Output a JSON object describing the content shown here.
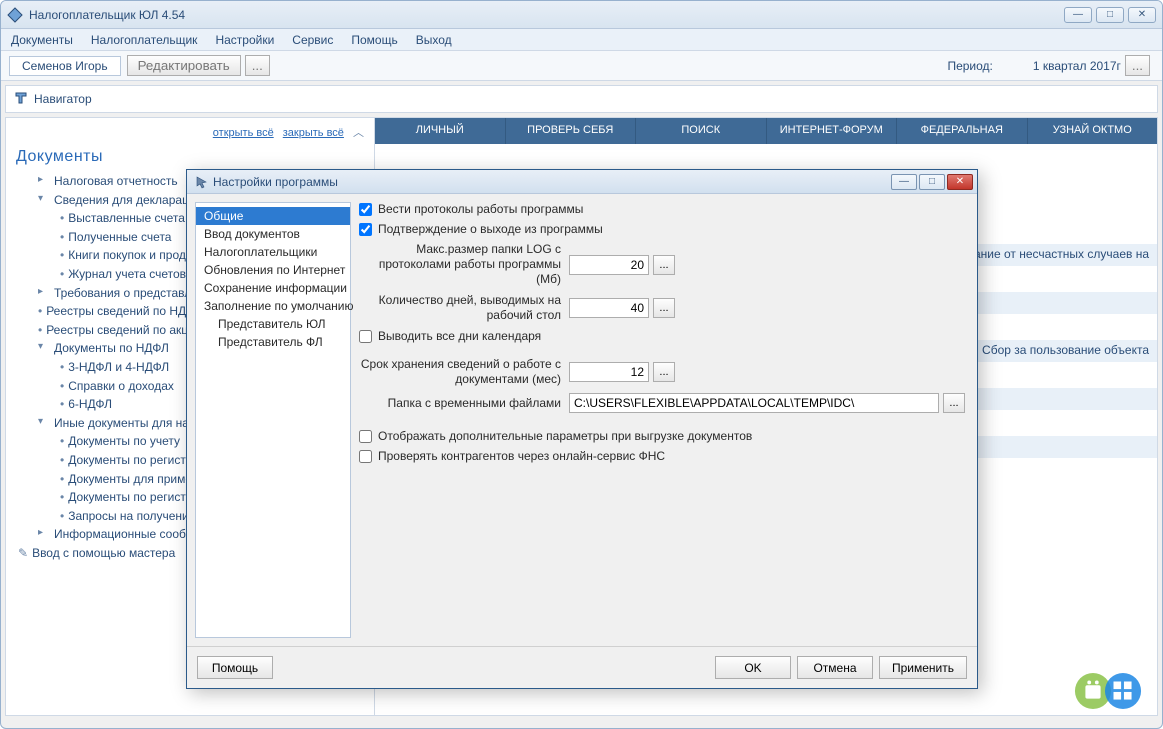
{
  "app": {
    "title": "Налогоплательщик ЮЛ 4.54"
  },
  "menubar": [
    "Документы",
    "Налогоплательщик",
    "Настройки",
    "Сервис",
    "Помощь",
    "Выход"
  ],
  "toolbar": {
    "user": "Семенов Игорь",
    "edit": "Редактировать",
    "ellipsis": "...",
    "period_label": "Период:",
    "period_value": "1 квартал 2017г"
  },
  "navigator": "Навигатор",
  "sidebar": {
    "open_all": "открыть всё",
    "close_all": "закрыть всё",
    "heading": "Документы",
    "tree": [
      {
        "level": 1,
        "arrow": "▸",
        "text": "Налоговая отчетность"
      },
      {
        "level": 1,
        "arrow": "▾",
        "text": "Сведения для декларации по ЕССС"
      },
      {
        "level": 2,
        "bullet": "•",
        "text": "Выставленные счета"
      },
      {
        "level": 2,
        "bullet": "•",
        "text": "Полученные счета"
      },
      {
        "level": 2,
        "bullet": "•",
        "text": "Книги покупок и продаж"
      },
      {
        "level": 2,
        "bullet": "•",
        "text": "Журнал учета счетов-фактур"
      },
      {
        "level": 1,
        "arrow": "▸",
        "text": "Требования о представлении"
      },
      {
        "level": 1,
        "bullet": "•",
        "text": "Реестры сведений по НДС"
      },
      {
        "level": 1,
        "bullet": "•",
        "text": "Реестры сведений по акцизам"
      },
      {
        "level": 1,
        "arrow": "▾",
        "text": "Документы по НДФЛ"
      },
      {
        "level": 2,
        "bullet": "•",
        "text": "3-НДФЛ и 4-НДФЛ"
      },
      {
        "level": 2,
        "bullet": "•",
        "text": "Справки о доходах"
      },
      {
        "level": 2,
        "bullet": "•",
        "text": "6-НДФЛ"
      },
      {
        "level": 1,
        "arrow": "▾",
        "text": "Иные документы для налоговых органов"
      },
      {
        "level": 2,
        "bullet": "•",
        "text": "Документы по учету"
      },
      {
        "level": 2,
        "bullet": "•",
        "text": "Документы по регистрации"
      },
      {
        "level": 2,
        "bullet": "•",
        "text": "Документы для применения патентной системы"
      },
      {
        "level": 2,
        "bullet": "•",
        "text": "Документы по регистрации бизнеса"
      },
      {
        "level": 2,
        "bullet": "•",
        "text": "Запросы на получение"
      },
      {
        "level": 1,
        "arrow": "▸",
        "text": "Информационные сообщения"
      },
      {
        "level": 0,
        "icon": true,
        "text": "Ввод с помощью мастера"
      }
    ]
  },
  "tabs": [
    "ЛИЧНЫЙ",
    "ПРОВЕРЬ СЕБЯ",
    "ПОИСК",
    "ИНТЕРНЕТ-ФОРУМ",
    "ФЕДЕРАЛЬНАЯ",
    "УЗНАЙ ОКТМО"
  ],
  "rows_behind": [
    "вание от несчастных случаев на",
    "",
    "ес, Сбор за пользование объекта"
  ],
  "dialog": {
    "title": "Настройки программы",
    "nav": [
      {
        "label": "Общие",
        "selected": true
      },
      {
        "label": "Ввод документов"
      },
      {
        "label": "Налогоплательщики"
      },
      {
        "label": "Обновления по Интернет"
      },
      {
        "label": "Сохранение информации"
      },
      {
        "label": "Заполнение по умолчанию"
      },
      {
        "label": "Представитель ЮЛ",
        "indent": true
      },
      {
        "label": "Представитель ФЛ",
        "indent": true
      }
    ],
    "form": {
      "cb_log": "Вести протоколы работы программы",
      "cb_confirm_exit": "Подтверждение о выходе из программы",
      "lab_log_size": "Макс.размер папки LOG с протоколами работы программы (Мб)",
      "val_log_size": "20",
      "lab_days": "Количество дней, выводимых на рабочий стол",
      "val_days": "40",
      "cb_all_days": "Выводить все дни календаря",
      "lab_retention": "Срок хранения сведений о работе с документами (мес)",
      "val_retention": "12",
      "lab_temp": "Папка с временными файлами",
      "val_temp": "C:\\USERS\\FLEXIBLE\\APPDATA\\LOCAL\\TEMP\\IDC\\",
      "cb_extra_params": "Отображать дополнительные параметры при выгрузке документов",
      "cb_check_fns": "Проверять контрагентов через онлайн-сервис ФНС"
    },
    "footer": {
      "help": "Помощь",
      "ok": "OK",
      "cancel": "Отмена",
      "apply": "Применить"
    }
  }
}
